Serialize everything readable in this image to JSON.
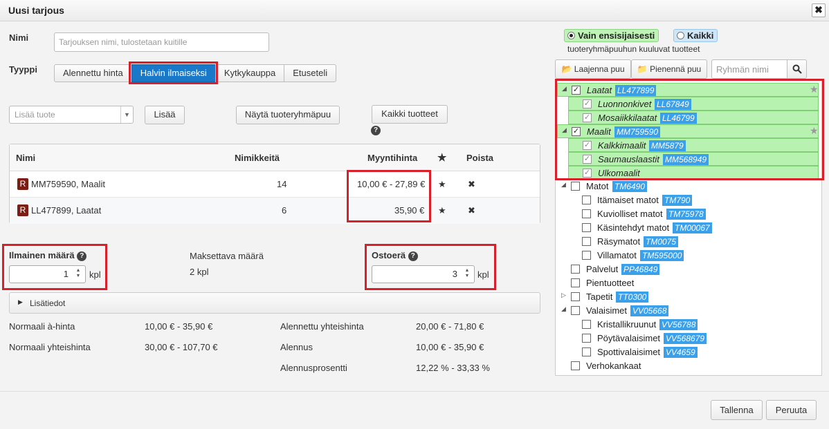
{
  "window": {
    "title": "Uusi tarjous",
    "close_glyph": "✖"
  },
  "form": {
    "name_label": "Nimi",
    "name_placeholder": "Tarjouksen nimi, tulostetaan kuitille",
    "type_label": "Tyyppi",
    "type_options": [
      "Alennettu hinta",
      "Halvin ilmaiseksi",
      "Kytkykauppa",
      "Etuseteli"
    ],
    "type_selected": "Halvin ilmaiseksi",
    "add_product_placeholder": "Lisää tuote",
    "add_button": "Lisää",
    "show_tree_button": "Näytä tuoteryhmäpuu",
    "all_products_button": "Kaikki tuotteet",
    "help_glyph": "?"
  },
  "table": {
    "columns": [
      "Nimi",
      "Nimikkeitä",
      "Myyntihinta",
      "★",
      "Poista"
    ],
    "rows": [
      {
        "badge": "R",
        "name": "MM759590, Maalit",
        "count": "14",
        "price": "10,00 € - 27,89 €",
        "star": "★",
        "remove": "✖"
      },
      {
        "badge": "R",
        "name": "LL477899, Laatat",
        "count": "6",
        "price": "35,90 €",
        "star": "★",
        "remove": "✖"
      }
    ]
  },
  "quantities": {
    "free_label": "Ilmainen määrä",
    "free_value": "1",
    "unit": "kpl",
    "paid_label": "Maksettava määrä",
    "paid_value": "2 kpl",
    "batch_label": "Ostoerä",
    "batch_value": "3"
  },
  "details": {
    "label": "Lisätiedot"
  },
  "summary": [
    {
      "label": "Normaali à-hinta",
      "value": "10,00 € - 35,90 €"
    },
    {
      "label": "Normaali yhteishinta",
      "value": "30,00 € - 107,70 €"
    },
    {
      "label": "Alennettu yhteishinta",
      "value": "20,00 € - 71,80 €"
    },
    {
      "label": "Alennus",
      "value": "10,00 € - 35,90 €"
    },
    {
      "label": "Alennusprosentti",
      "value": "12,22 % - 33,33 %"
    }
  ],
  "filter": {
    "option_primary": "Vain ensisijaisesti",
    "option_all": "Kaikki",
    "selected": "Vain ensisijaisesti",
    "note": "tuoteryhmäpuuhun kuuluvat tuotteet",
    "expand_button": "Laajenna puu",
    "collapse_button": "Pienennä puu",
    "group_search_placeholder": "Ryhmän nimi"
  },
  "tree": [
    {
      "label": "Laatat",
      "code": "LL477899",
      "level": 0,
      "toggle": "◢",
      "checked": true,
      "highlight": true,
      "italic": true,
      "star": true
    },
    {
      "label": "Luonnonkivet",
      "code": "LL67849",
      "level": 1,
      "checked": true,
      "highlight": true,
      "italic": true
    },
    {
      "label": "Mosaiikkilaatat",
      "code": "LL46799",
      "level": 1,
      "checked": true,
      "highlight": true,
      "italic": true
    },
    {
      "label": "Maalit",
      "code": "MM759590",
      "level": 0,
      "toggle": "◢",
      "checked": true,
      "highlight": true,
      "italic": true,
      "star": true
    },
    {
      "label": "Kalkkimaalit",
      "code": "MM5879",
      "level": 1,
      "checked": true,
      "highlight": true,
      "italic": true
    },
    {
      "label": "Saumauslaastit",
      "code": "MM568949",
      "level": 1,
      "checked": true,
      "highlight": true,
      "italic": true
    },
    {
      "label": "Ulkomaalit",
      "code": "",
      "level": 1,
      "checked": true,
      "highlight": true,
      "italic": true
    },
    {
      "label": "Matot",
      "code": "TM6490",
      "level": 0,
      "toggle": "◢",
      "checked": false
    },
    {
      "label": "Itämaiset matot",
      "code": "TM790",
      "level": 1,
      "checked": false
    },
    {
      "label": "Kuviolliset matot",
      "code": "TM75978",
      "level": 1,
      "checked": false
    },
    {
      "label": "Käsintehdyt matot",
      "code": "TM00067",
      "level": 1,
      "checked": false
    },
    {
      "label": "Räsymatot",
      "code": "TM0075",
      "level": 1,
      "checked": false
    },
    {
      "label": "Villamatot",
      "code": "TM595000",
      "level": 1,
      "checked": false
    },
    {
      "label": "Palvelut",
      "code": "PP46849",
      "level": 0,
      "checked": false
    },
    {
      "label": "Pientuotteet",
      "code": "",
      "level": 0,
      "checked": false
    },
    {
      "label": "Tapetit",
      "code": "TT0300",
      "level": 0,
      "toggle": "▷",
      "checked": false
    },
    {
      "label": "Valaisimet",
      "code": "VV05668",
      "level": 0,
      "toggle": "◢",
      "checked": false
    },
    {
      "label": "Kristallikruunut",
      "code": "VV56788",
      "level": 1,
      "checked": false
    },
    {
      "label": "Pöytävalaisimet",
      "code": "VV568679",
      "level": 1,
      "checked": false
    },
    {
      "label": "Spottivalaisimet",
      "code": "VV4659",
      "level": 1,
      "checked": false
    },
    {
      "label": "Verhokankaat",
      "code": "",
      "level": 0,
      "checked": false
    }
  ],
  "footer": {
    "save_button": "Tallenna",
    "cancel_button": "Peruuta"
  },
  "colors": {
    "accent": "#1a78c9",
    "highlight_red": "#d9202a",
    "tree_highlight": "#b8f2b0",
    "tag_blue": "#3aa0ea",
    "badge_brown": "#7b1f14"
  }
}
